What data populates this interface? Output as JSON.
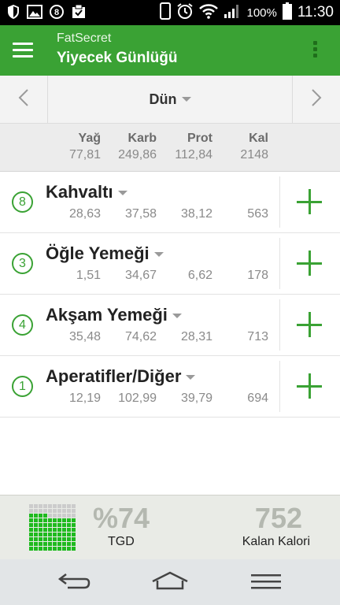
{
  "status_bar": {
    "battery": "100%",
    "time": "11:30",
    "icons": [
      "shield-icon",
      "image-icon",
      "bubble-b-icon",
      "clipboard-check-icon",
      "phone-outline-icon",
      "alarm-icon",
      "wifi-icon",
      "signal-icon",
      "battery-icon"
    ]
  },
  "app_bar": {
    "app_name": "FatSecret",
    "title": "Yiyecek Günlüğü",
    "icons": [
      "menu-icon",
      "overflow-menu-icon"
    ]
  },
  "date_nav": {
    "label": "Dün",
    "icons": [
      "chevron-left-icon",
      "chevron-right-icon",
      "caret-down-icon"
    ]
  },
  "totals": {
    "headers": [
      "Yağ",
      "Karb",
      "Prot",
      "Kal"
    ],
    "values": [
      "77,81",
      "249,86",
      "112,84",
      "2148"
    ]
  },
  "meals": [
    {
      "count": "8",
      "name": "Kahvaltı",
      "values": [
        "28,63",
        "37,58",
        "38,12",
        "563"
      ]
    },
    {
      "count": "3",
      "name": "Öğle Yemeği",
      "values": [
        "1,51",
        "34,67",
        "6,62",
        "178"
      ]
    },
    {
      "count": "4",
      "name": "Akşam Yemeği",
      "values": [
        "35,48",
        "74,62",
        "28,31",
        "713"
      ]
    },
    {
      "count": "1",
      "name": "Aperatifler/Diğer",
      "values": [
        "12,19",
        "102,99",
        "39,79",
        "694"
      ]
    }
  ],
  "summary": {
    "rdi_percent": "%74",
    "rdi_label": "TGD",
    "rdi_fraction": 0.74,
    "remaining": "752",
    "remaining_label": "Kalan Kalori"
  },
  "colors": {
    "brand": "#3aa234",
    "grid_fill": "#1fba1f"
  }
}
